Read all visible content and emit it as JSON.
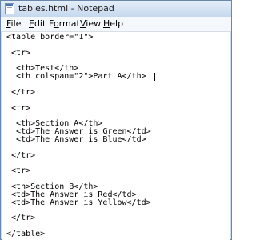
{
  "window": {
    "title": "tables.html - Notepad",
    "icon": "notepad-icon"
  },
  "menu": {
    "file": {
      "accel": "F",
      "rest": "ile"
    },
    "edit": {
      "accel": "E",
      "rest": "dit"
    },
    "format": {
      "pre": "F",
      "accel": "o",
      "rest": "rmat"
    },
    "view": {
      "accel": "V",
      "rest": "iew"
    },
    "help": {
      "accel": "H",
      "rest": "elp"
    }
  },
  "editor": {
    "lines": [
      " <table border=\"1\">",
      "",
      "  <tr>",
      "",
      "   <th>Test</th>",
      "   <th colspan=\"2\">Part A</th>",
      "",
      "  </tr>",
      "",
      "  <tr>",
      "",
      "   <th>Section A</th>",
      "   <td>The Answer is Green</td>",
      "   <td>The Answer is Blue</td>",
      "",
      "  </tr>",
      "",
      "  <tr>",
      "",
      "  <th>Section B</th>",
      "  <td>The Answer is Red</td>",
      "  <td>The Answer is Yellow</td>",
      "",
      "  </tr>",
      "",
      " </table>"
    ]
  }
}
